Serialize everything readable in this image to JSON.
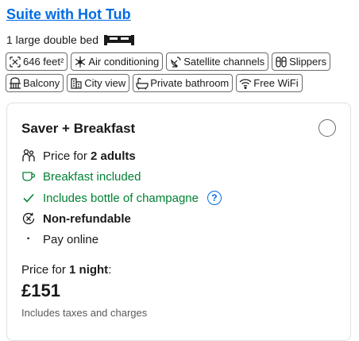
{
  "room": {
    "title": "Suite with Hot Tub",
    "bed": "1 large double bed"
  },
  "facilities": [
    {
      "icon": "floor-area-icon",
      "label": "646 feet²"
    },
    {
      "icon": "snowflake-icon",
      "label": "Air conditioning"
    },
    {
      "icon": "satellite-dish-icon",
      "label": "Satellite channels"
    },
    {
      "icon": "slippers-icon",
      "label": "Slippers"
    },
    {
      "icon": "balcony-icon",
      "label": "Balcony"
    },
    {
      "icon": "city-icon",
      "label": "City view"
    },
    {
      "icon": "bath-icon",
      "label": "Private bathroom"
    },
    {
      "icon": "wifi-icon",
      "label": "Free WiFi"
    }
  ],
  "offer": {
    "title": "Saver + Breakfast",
    "price_for_prefix": "Price for ",
    "adults": "2 adults",
    "breakfast": "Breakfast included",
    "champagne": "Includes bottle of champagne",
    "help": "?",
    "refund": "Non-refundable",
    "payment": "Pay online",
    "stay_prefix": "Price for ",
    "stay_nights": "1 night",
    "stay_suffix": ":",
    "price": "£151",
    "taxes": "Includes taxes and charges"
  },
  "colors": {
    "link": "#006ce4",
    "positive": "#008234"
  }
}
